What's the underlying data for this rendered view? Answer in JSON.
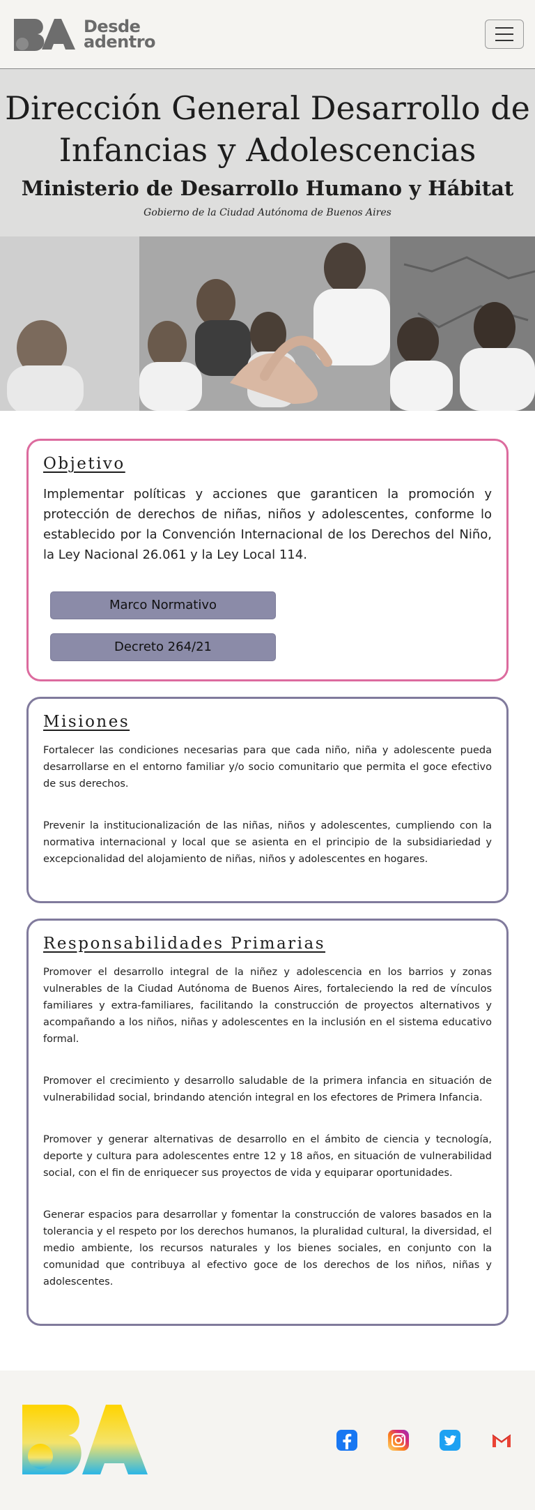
{
  "navbar": {
    "brand_line1": "Desde",
    "brand_line2": "adentro",
    "menu_icon": "hamburger-menu-icon"
  },
  "header": {
    "title": "Dirección General Desarrollo de Infancias y Adolescencias",
    "subtitle": "Ministerio de Desarrollo Humano y Hábitat",
    "government": "Gobierno de la Ciudad Autónoma de Buenos Aires"
  },
  "objetivo": {
    "title": "Objetivo",
    "text": "Implementar políticas y acciones que garanticen la promoción y protección de derechos de niñas, niños y adolescentes, conforme lo establecido por la Convención Internacional de los Derechos del Niño, la Ley Nacional 26.061 y la Ley Local 114.",
    "buttons": [
      "Marco Normativo",
      "Decreto 264/21"
    ]
  },
  "misiones": {
    "title": "Misiones",
    "paragraphs": [
      "Fortalecer las condiciones necesarias para que cada niño, niña y adolescente pueda desarrollarse en el entorno familiar y/o socio comunitario que permita el goce efectivo de sus derechos.",
      "Prevenir la institucionalización de las niñas, niños y adolescentes, cumpliendo con la normativa internacional y local que se asienta en el principio de la subsidiariedad y excepcionalidad del alojamiento de niñas, niños y adolescentes en hogares."
    ]
  },
  "responsabilidades": {
    "title": "Responsabilidades Primarias",
    "paragraphs": [
      "Promover el desarrollo integral de la niñez y adolescencia en los barrios y zonas vulnerables de la Ciudad Autónoma de Buenos Aires, fortaleciendo la red de vínculos familiares y extra-familiares, facilitando la construcción de proyectos alternativos y acompañando a los niños, niñas y adolescentes en la inclusión en el sistema educativo formal.",
      "Promover el crecimiento y desarrollo saludable de la primera infancia en situación de vulnerabilidad social, brindando atención integral en los efectores de Primera Infancia.",
      "Promover y generar alternativas de desarrollo en el ámbito de ciencia y tecnología, deporte y cultura para adolescentes entre 12 y 18 años, en situación de vulnerabilidad social, con el fin de enriquecer sus proyectos de vida y equiparar oportunidades.",
      "Generar espacios para desarrollar y fomentar la construcción de valores basados en la tolerancia y el respeto por los derechos humanos, la pluralidad cultural, la diversidad, el medio ambiente, los recursos naturales y los bienes sociales, en conjunto con la comunidad que contribuya al efectivo goce de los derechos de los niños, niñas y adolescentes."
    ]
  },
  "footer": {
    "socials": [
      "facebook-icon",
      "instagram-icon",
      "twitter-icon",
      "gmail-icon"
    ]
  },
  "colors": {
    "objetivo_border": "#dc6b9e",
    "card_border": "#807a9c",
    "button_bg": "#8b8ba8",
    "facebook": "#1877f2",
    "twitter": "#1da1f2",
    "gmail": "#ea4335"
  }
}
